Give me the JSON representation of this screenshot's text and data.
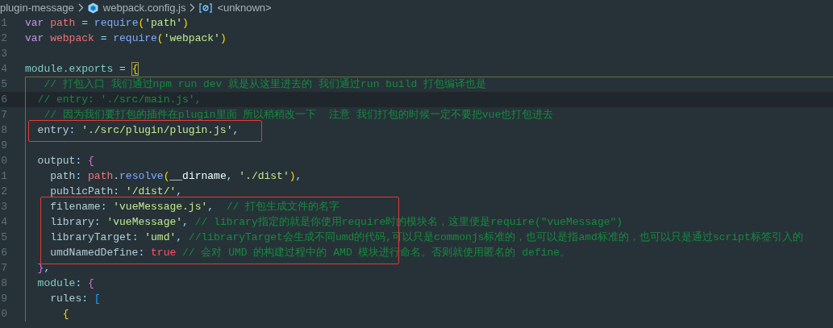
{
  "breadcrumb": [
    {
      "kind": "folder",
      "label": "plugin-message"
    },
    {
      "kind": "file",
      "label": "webpack.config.js"
    },
    {
      "kind": "symbol",
      "label": "<unknown>"
    }
  ],
  "editor": {
    "blocks": [
      {
        "boxed": false,
        "lines": [
          {
            "number": "1",
            "current": false,
            "tokens": [
              {
                "kind": "keyword",
                "text": "var "
              },
              {
                "kind": "variable",
                "text": "path"
              },
              {
                "kind": "punct",
                "text": " = "
              },
              {
                "kind": "function",
                "text": "require"
              },
              {
                "kind": "paren",
                "text": "("
              },
              {
                "kind": "string",
                "text": "'path'"
              },
              {
                "kind": "paren",
                "text": ")"
              }
            ]
          },
          {
            "number": "2",
            "current": false,
            "tokens": [
              {
                "kind": "keyword",
                "text": "var "
              },
              {
                "kind": "variable",
                "text": "webpack"
              },
              {
                "kind": "punct",
                "text": " = "
              },
              {
                "kind": "function",
                "text": "require"
              },
              {
                "kind": "paren",
                "text": "("
              },
              {
                "kind": "string",
                "text": "'webpack'"
              },
              {
                "kind": "paren",
                "text": ")"
              }
            ]
          },
          {
            "number": "3",
            "current": false
          },
          {
            "number": "4",
            "current": false,
            "tokens": [
              {
                "kind": "object",
                "text": "module.exports"
              },
              {
                "kind": "punct",
                "text": " = "
              },
              {
                "kind": "brace-matched",
                "text": "{"
              }
            ]
          },
          {
            "number": "5",
            "current": false,
            "tokens": [
              {
                "kind": "comment",
                "text": "   // 打包入口 我们通过npm run dev 就是从这里进去的 我们通过run build 打包编译也是"
              }
            ]
          },
          {
            "number": "6",
            "current": true,
            "tokens": [
              {
                "kind": "comment",
                "text": "  // entry: './src/main.js',"
              }
            ]
          },
          {
            "number": "7",
            "current": false,
            "tokens": [
              {
                "kind": "comment",
                "text": "   // 因为我们要打包的插件在plugin里面 所以稍稍改一下  注意 我们打包的时候一定不要把vue也打包进去"
              }
            ]
          }
        ]
      },
      {
        "boxed": true,
        "lines": [
          {
            "number": "8",
            "current": false,
            "tokens": [
              {
                "kind": "property",
                "text": "  entry"
              },
              {
                "kind": "punct",
                "text": ": "
              },
              {
                "kind": "string",
                "text": "'./src/plugin/plugin.js'"
              },
              {
                "kind": "punct",
                "text": ","
              }
            ]
          }
        ]
      },
      {
        "boxed": false,
        "lines": [
          {
            "number": "9",
            "current": false
          },
          {
            "number": "0",
            "current": false,
            "tokens": [
              {
                "kind": "property",
                "text": "  output"
              },
              {
                "kind": "punct",
                "text": ": "
              },
              {
                "kind": "brace-pink",
                "text": "{"
              }
            ]
          },
          {
            "number": "1",
            "current": false,
            "tokens": [
              {
                "kind": "property",
                "text": "    path"
              },
              {
                "kind": "punct",
                "text": ": "
              },
              {
                "kind": "variable",
                "text": "path"
              },
              {
                "kind": "punct",
                "text": "."
              },
              {
                "kind": "function",
                "text": "resolve"
              },
              {
                "kind": "paren",
                "text": "("
              },
              {
                "kind": "plain",
                "text": "__dirname"
              },
              {
                "kind": "punct",
                "text": ", "
              },
              {
                "kind": "string",
                "text": "'./dist'"
              },
              {
                "kind": "paren",
                "text": ")"
              },
              {
                "kind": "punct",
                "text": ","
              }
            ]
          },
          {
            "number": "2",
            "current": false,
            "tokens": [
              {
                "kind": "property",
                "text": "    publicPath"
              },
              {
                "kind": "punct",
                "text": ": "
              },
              {
                "kind": "string",
                "text": "'/dist/'"
              },
              {
                "kind": "punct",
                "text": ","
              }
            ]
          }
        ]
      },
      {
        "boxed": true,
        "lines": [
          {
            "number": "3",
            "current": false,
            "tokens": [
              {
                "kind": "property",
                "text": "    filename"
              },
              {
                "kind": "punct",
                "text": ": "
              },
              {
                "kind": "string",
                "text": "'vueMessage.js'"
              },
              {
                "kind": "punct",
                "text": ",  "
              },
              {
                "kind": "comment",
                "text": "// 打包生成文件的名字"
              }
            ]
          },
          {
            "number": "4",
            "current": false,
            "tokens": [
              {
                "kind": "property",
                "text": "    library"
              },
              {
                "kind": "punct",
                "text": ": "
              },
              {
                "kind": "string",
                "text": "'vueMessage'"
              },
              {
                "kind": "punct",
                "text": ", "
              },
              {
                "kind": "comment",
                "text": "// library指定的就是你使用require时的模块名，这里便是require(\"vueMessage\")"
              }
            ]
          },
          {
            "number": "5",
            "current": false,
            "tokens": [
              {
                "kind": "property",
                "text": "    libraryTarget"
              },
              {
                "kind": "punct",
                "text": ": "
              },
              {
                "kind": "string",
                "text": "'umd'"
              },
              {
                "kind": "punct",
                "text": ", "
              },
              {
                "kind": "comment",
                "text": "//libraryTarget会生成不同umd的代码,可以只是commonjs标准的，也可以是指amd标准的，也可以只是通过script标签引入的"
              }
            ]
          },
          {
            "number": "6",
            "current": false,
            "tokens": [
              {
                "kind": "property",
                "text": "    umdNamedDefine"
              },
              {
                "kind": "punct",
                "text": ": "
              },
              {
                "kind": "boolean",
                "text": "true"
              },
              {
                "kind": "comment",
                "text": " // 会对 UMD 的构建过程中的 AMD 模块进行命名。否则就使用匿名的 define。"
              }
            ]
          }
        ]
      },
      {
        "boxed": false,
        "lines": [
          {
            "number": "7",
            "current": false,
            "tokens": [
              {
                "kind": "brace-pink",
                "text": "  }"
              },
              {
                "kind": "punct",
                "text": ","
              }
            ]
          },
          {
            "number": "8",
            "current": false,
            "tokens": [
              {
                "kind": "object",
                "text": "  module"
              },
              {
                "kind": "punct",
                "text": ": "
              },
              {
                "kind": "brace-pink",
                "text": "{"
              }
            ]
          },
          {
            "number": "9",
            "current": false,
            "tokens": [
              {
                "kind": "property",
                "text": "    rules"
              },
              {
                "kind": "punct",
                "text": ": "
              },
              {
                "kind": "bracket",
                "text": "["
              }
            ]
          },
          {
            "number": "0",
            "current": false,
            "tokens": [
              {
                "kind": "brace",
                "text": "      {"
              }
            ]
          }
        ]
      }
    ]
  }
}
